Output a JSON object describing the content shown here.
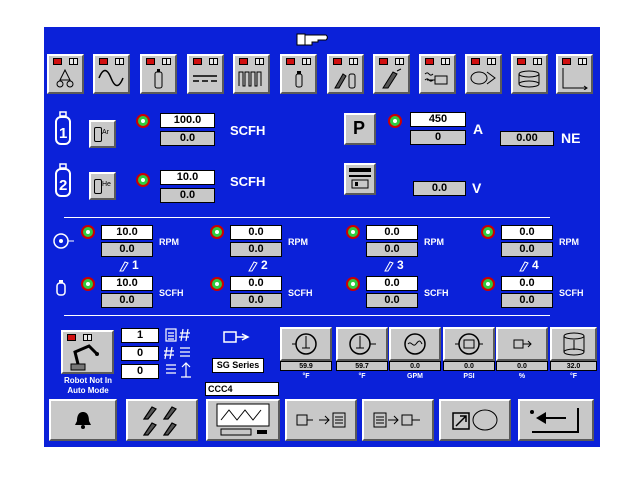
{
  "header": {
    "icon": "pointing-hand-icon"
  },
  "toolbar": {
    "buttons": [
      {
        "name": "process-icon"
      },
      {
        "name": "sine-wave-icon"
      },
      {
        "name": "gas-bottle-icon"
      },
      {
        "name": "dc-lines-icon"
      },
      {
        "name": "pulse-wave-icon"
      },
      {
        "name": "bottle-small-icon"
      },
      {
        "name": "torch-bottle-icon"
      },
      {
        "name": "torch-icon"
      },
      {
        "name": "wire-feed-icon"
      },
      {
        "name": "feed-roll-icon"
      },
      {
        "name": "cooler-icon"
      },
      {
        "name": "graph-axis-icon"
      }
    ]
  },
  "gas1": {
    "number": "1",
    "gas": "Ar",
    "set": "100.0",
    "act": "0.0",
    "unit": "SCFH"
  },
  "gas2": {
    "number": "2",
    "gas": "He",
    "set": "10.0",
    "act": "0.0",
    "unit": "SCFH"
  },
  "power": {
    "p_label": "P",
    "set": "450",
    "act": "0",
    "amp_unit": "A",
    "ne_value": "0.00",
    "ne_unit": "NE",
    "volt_value": "0.0",
    "volt_unit": "V"
  },
  "wire": {
    "units": [
      "RPM",
      "RPM",
      "RPM",
      "RPM"
    ],
    "gas_units": [
      "SCFH",
      "SCFH",
      "SCFH",
      "SCFH"
    ],
    "rpm_set": [
      "10.0",
      "0.0",
      "0.0",
      "0.0"
    ],
    "rpm_act": [
      "0.0",
      "0.0",
      "0.0",
      "0.0"
    ],
    "torch_nums": [
      "1",
      "2",
      "3",
      "4"
    ],
    "gas_set": [
      "10.0",
      "0.0",
      "0.0",
      "0.0"
    ],
    "gas_act": [
      "0.0",
      "0.0",
      "0.0",
      "0.0"
    ]
  },
  "robot": {
    "status_line1": "Robot Not In",
    "status_line2": "Auto Mode"
  },
  "counters": [
    "1",
    "0",
    "0"
  ],
  "series": {
    "label": "SG Series",
    "input": "CCC4"
  },
  "sensors": [
    {
      "value": "59.9",
      "unit": "°F",
      "icon": "thermometer-in-icon"
    },
    {
      "value": "59.7",
      "unit": "°F",
      "icon": "thermometer-out-icon"
    },
    {
      "value": "0.0",
      "unit": "GPM",
      "icon": "flow-meter-icon"
    },
    {
      "value": "0.0",
      "unit": "PSI",
      "icon": "pressure-gauge-icon"
    },
    {
      "value": "0.0",
      "unit": "%",
      "icon": "wire-percent-icon"
    },
    {
      "value": "32.0",
      "unit": "°F",
      "icon": "tank-temp-icon"
    }
  ]
}
